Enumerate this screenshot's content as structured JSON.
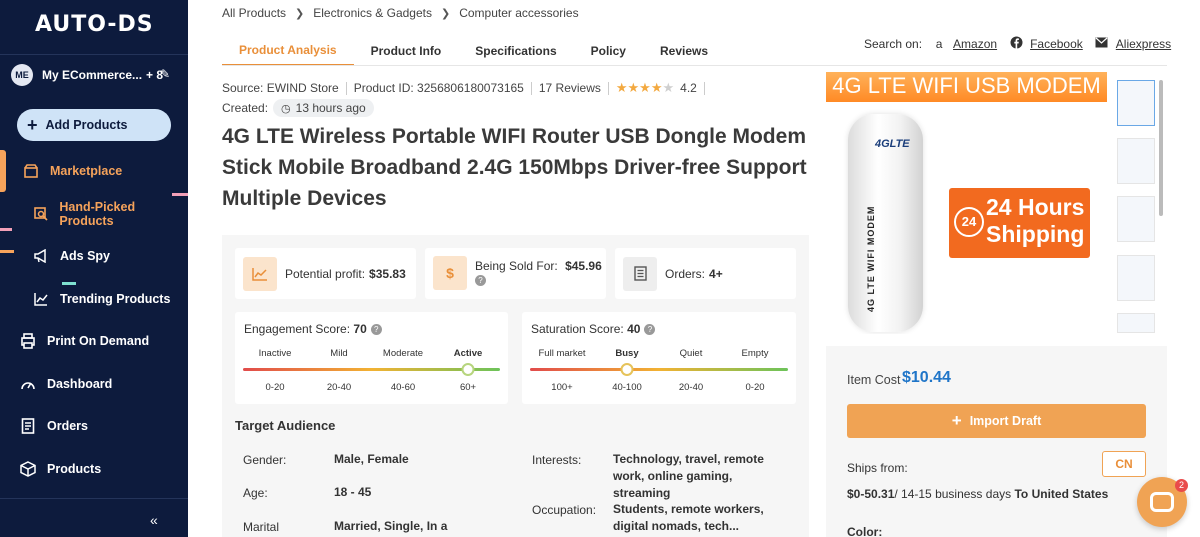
{
  "sidebar": {
    "logo": "AUTO-DS",
    "store_avatar": "ME",
    "store_name": "My ECommerce...",
    "store_count": "+ 8",
    "add_products": "Add Products",
    "items": [
      {
        "label": "Marketplace",
        "icon": "store-icon",
        "active": true
      },
      {
        "label": "Hand-Picked Products",
        "icon": "handpicked-icon",
        "active": true
      },
      {
        "label": "Ads Spy",
        "icon": "megaphone-icon",
        "active": false
      },
      {
        "label": "Trending Products",
        "icon": "trending-icon",
        "active": false
      },
      {
        "label": "Print On Demand",
        "icon": "print-icon",
        "active": false
      },
      {
        "label": "Dashboard",
        "icon": "gauge-icon",
        "active": false
      },
      {
        "label": "Orders",
        "icon": "orders-icon",
        "active": false
      },
      {
        "label": "Products",
        "icon": "box-icon",
        "active": false
      }
    ],
    "collapse": "«"
  },
  "breadcrumb": [
    "All Products",
    "Electronics & Gadgets",
    "Computer accessories"
  ],
  "tabs": [
    "Product Analysis",
    "Product Info",
    "Specifications",
    "Policy",
    "Reviews"
  ],
  "search_on": {
    "label": "Search on:",
    "links": [
      "Amazon",
      "Facebook",
      "Aliexpress"
    ]
  },
  "meta": {
    "source": "Source: EWIND Store",
    "product_id": "Product ID: 3256806180073165",
    "reviews": "17 Reviews",
    "rating": "4.2",
    "created_label": "Created:",
    "created_value": "13 hours ago"
  },
  "product_title": "4G LTE Wireless Portable WIFI Router USB Dongle Modem Stick Mobile Broadband 2.4G 150Mbps Driver-free Support Multiple Devices",
  "stats": {
    "profit_label": "Potential profit:",
    "profit_value": "$35.83",
    "sold_label": "Being Sold For:",
    "sold_value": "$45.96",
    "orders_label": "Orders:",
    "orders_value": "4+"
  },
  "engagement": {
    "label": "Engagement Score:",
    "value": "70",
    "levels": [
      "Inactive",
      "Mild",
      "Moderate",
      "Active"
    ],
    "ranges": [
      "0-20",
      "20-40",
      "40-60",
      "60+"
    ],
    "active_level": "Active"
  },
  "saturation": {
    "label": "Saturation Score:",
    "value": "40",
    "levels": [
      "Full market",
      "Busy",
      "Quiet",
      "Empty"
    ],
    "ranges": [
      "100+",
      "40-100",
      "20-40",
      "0-20"
    ],
    "active_level": "Busy"
  },
  "audience": {
    "title": "Target Audience",
    "gender_label": "Gender:",
    "gender_value": "Male, Female",
    "age_label": "Age:",
    "age_value": "18 - 45",
    "marital_label": "Marital",
    "marital_value": "Married, Single, In a",
    "interests_label": "Interests:",
    "interests_value": "Technology, travel, remote work, online gaming, streaming",
    "occupation_label": "Occupation:",
    "occupation_value": "Students, remote workers, digital nomads, tech..."
  },
  "image": {
    "banner": "4G LTE WIFI USB MODEM",
    "dongle_brand": "4GLTE",
    "dongle_text": "4G LTE WIFI MODEM",
    "shipping_big": "24 Hours Shipping",
    "shipping_circle": "24"
  },
  "cost": {
    "item_cost_label": "Item Cost",
    "item_cost_value": "$10.44",
    "import_label": "Import Draft",
    "ships_from_label": "Ships from:",
    "ships_from_country": "CN",
    "ship_price": "$0-50.31",
    "ship_days": "/ 14-15 business days",
    "ship_to": "To United States",
    "color_label": "Color:"
  },
  "chat": {
    "badge": "2"
  },
  "colors": {
    "accent": "#e98f39",
    "sidebar": "#0d1b3d",
    "link_blue": "#1f75c8"
  }
}
